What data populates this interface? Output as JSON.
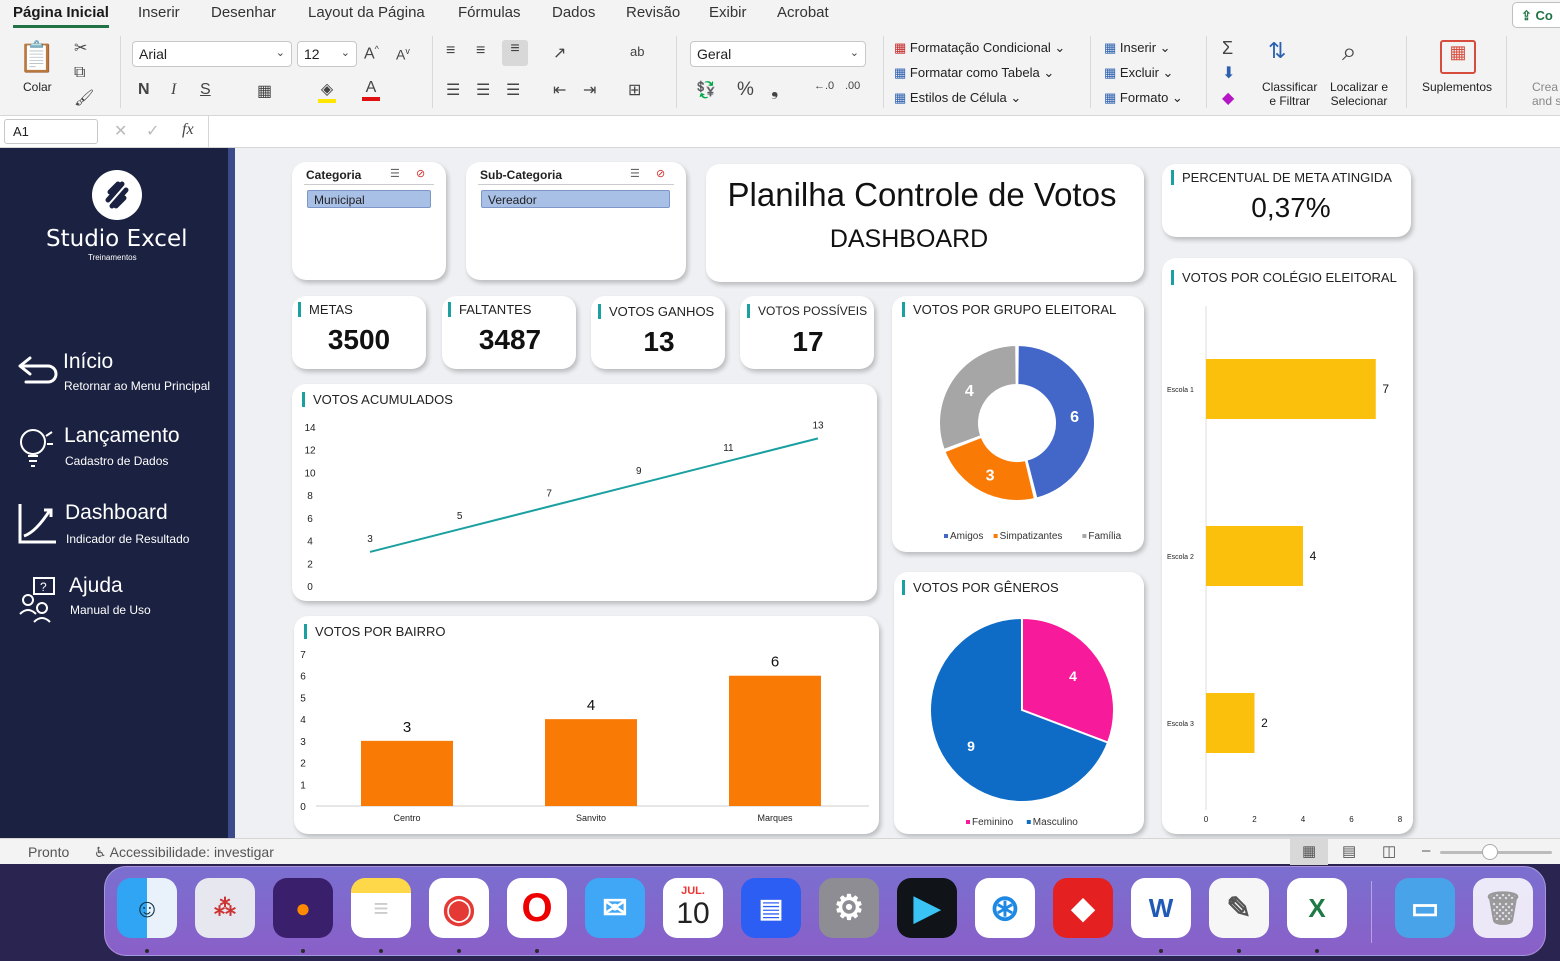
{
  "ribbon": {
    "tabs": [
      "Página Inicial",
      "Inserir",
      "Desenhar",
      "Layout da Página",
      "Fórmulas",
      "Dados",
      "Revisão",
      "Exibir",
      "Acrobat"
    ],
    "share_label": "Co",
    "paste_label": "Colar",
    "font_name": "Arial",
    "font_size": "12",
    "number_format": "Geral",
    "styles": [
      "Formatação Condicional",
      "Formatar como Tabela",
      "Estilos de Célula"
    ],
    "cells": [
      "Inserir",
      "Excluir",
      "Formato"
    ],
    "sort_label_1": "Classificar",
    "sort_label_2": "e Filtrar",
    "find_label_1": "Localizar e",
    "find_label_2": "Selecionar",
    "addins_label": "Suplementos",
    "create_label_1": "Crea",
    "create_label_2": "and sh",
    "bold": "N",
    "italic": "I",
    "underline": "S"
  },
  "formula_bar": {
    "name_box": "A1",
    "fx": "fx"
  },
  "sidebar": {
    "brand": "Studio Excel",
    "brand_sub": "Treinamentos",
    "items": [
      {
        "title": "Início",
        "subtitle": "Retornar ao Menu Principal",
        "icon": "return-arrow-icon"
      },
      {
        "title": "Lançamento",
        "subtitle": "Cadastro de Dados",
        "icon": "lightbulb-icon"
      },
      {
        "title": "Dashboard",
        "subtitle": "Indicador de Resultado",
        "icon": "chart-line-icon"
      },
      {
        "title": "Ajuda",
        "subtitle": "Manual de Uso",
        "icon": "help-people-icon"
      }
    ]
  },
  "slicers": [
    {
      "header": "Categoria",
      "selected": "Municipal"
    },
    {
      "header": "Sub-Categoria",
      "selected": "Vereador"
    }
  ],
  "header": {
    "title": "Planilha Controle de Votos",
    "subtitle": "DASHBOARD"
  },
  "meta_pct": {
    "label": "PERCENTUAL DE META ATINGIDA",
    "value": "0,37%"
  },
  "kpis": [
    {
      "label": "METAS",
      "value": "3500"
    },
    {
      "label": "FALTANTES",
      "value": "3487"
    },
    {
      "label": "VOTOS GANHOS",
      "value": "13"
    },
    {
      "label": "VOTOS POSSÍVEIS",
      "value": "17"
    }
  ],
  "status_bar": {
    "ready": "Pronto",
    "accessibility": "Accessibilidade: investigar"
  },
  "dock": {
    "calendar_month": "JUL.",
    "calendar_day": "10"
  },
  "colors": {
    "sidebar": "#1b2140",
    "accent": "#1aa0a0",
    "orange": "#fa7a06",
    "yellow": "#fbc00b",
    "blue": "#4267c8",
    "pink": "#f71a9a",
    "deep_blue": "#0f6cc6"
  },
  "chart_data": [
    {
      "type": "line",
      "title": "VOTOS ACUMULADOS",
      "values": [
        3,
        5,
        7,
        9,
        11,
        13
      ],
      "yticks": [
        "0",
        "2",
        "4",
        "6",
        "8",
        "10",
        "12",
        "14"
      ],
      "ylim": [
        0,
        14
      ],
      "color": "#1aa0a0"
    },
    {
      "type": "bar",
      "title": "VOTOS POR BAIRRO",
      "categories": [
        "Centro",
        "Sanvito",
        "Marques"
      ],
      "values": [
        3,
        4,
        6
      ],
      "yticks": [
        "0",
        "1",
        "2",
        "3",
        "4",
        "5",
        "6",
        "7"
      ],
      "ylim": [
        0,
        7
      ],
      "color": "#fa7a06"
    },
    {
      "type": "pie",
      "title": "VOTOS POR GRUPO ELEITORAL",
      "donut": true,
      "categories": [
        "Amigos",
        "Simpatizantes",
        "Família"
      ],
      "values": [
        6,
        3,
        4
      ],
      "colors": [
        "#4267c8",
        "#fa7a06",
        "#a6a6a6"
      ],
      "legend": "bottom"
    },
    {
      "type": "pie",
      "title": "VOTOS POR GÊNEROS",
      "categories": [
        "Feminino",
        "Masculino"
      ],
      "values": [
        4,
        9
      ],
      "colors": [
        "#f71a9a",
        "#0f6cc6"
      ],
      "legend": "bottom"
    },
    {
      "type": "bar",
      "orientation": "horizontal",
      "title": "VOTOS POR COLÉGIO ELEITORAL",
      "categories": [
        "Escola 1",
        "Escola 2",
        "Escola 3"
      ],
      "values": [
        7,
        4,
        2
      ],
      "xticks": [
        "0",
        "2",
        "4",
        "6",
        "8"
      ],
      "xlim": [
        0,
        8
      ],
      "color": "#fbc00b"
    }
  ]
}
